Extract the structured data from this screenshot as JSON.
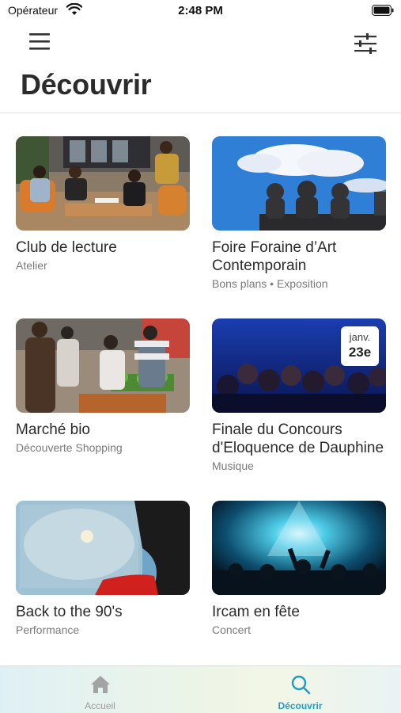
{
  "status_bar": {
    "carrier": "Opérateur",
    "time": "2:48 PM"
  },
  "header": {
    "title": "Découvrir"
  },
  "cards": [
    {
      "title": "Club de lecture",
      "subtitle": "Atelier"
    },
    {
      "title": "Foire Foraine d’Art Contemporain",
      "subtitle": "Bons plans • Exposition"
    },
    {
      "title": "Marché bio",
      "subtitle": "Découverte Shopping"
    },
    {
      "title": "Finale du Concours d'Eloquence de Dauphine",
      "subtitle": "Musique",
      "date_month": "janv.",
      "date_day": "23e"
    },
    {
      "title": "Back to the 90's",
      "subtitle": "Performance"
    },
    {
      "title": "Ircam en fête",
      "subtitle": "Concert"
    }
  ],
  "tab_bar": {
    "home_label": "Accueil",
    "discover_label": "Découvrir",
    "active_color": "#1e9cc4",
    "inactive_color": "#9a9a9a"
  }
}
